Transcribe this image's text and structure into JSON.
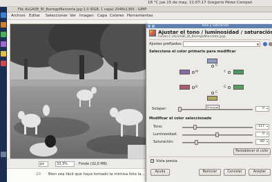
{
  "topbar": {
    "status_text": "18 °C  jue 15 de may, 11:07:17   Gregorio Pérez Compañ"
  },
  "window": {
    "title": "File  ALGADE_BI_BorregoMarcente.jpg-1.0 (RGB, 1 capa) 2048x1365 - GIMP",
    "menu": [
      "Archivo",
      "Editar",
      "Seleccionar",
      "Ver",
      "Imagen",
      "Capa",
      "Colores",
      "Herramientas"
    ]
  },
  "statusbar": {
    "unit": "px",
    "zoom": "33,3%",
    "info": "Fondo (32,0 MB)"
  },
  "doc": {
    "line_number": "20",
    "text": "Bien sea fácil que haya tomado la mimisa foto la..."
  },
  "dialog": {
    "titlebar": "Tono y saturación",
    "heading": "Ajustar el tono / luminosidad / saturación",
    "subheading": "Fondo-1 (ALGADE_BI_BorregoMarcente.jpg)",
    "presets_label": "Ajustes prefijados:",
    "primary_label": "Seleccione el color primario para modificar",
    "radio_labels": {
      "r": "R",
      "y": "Y",
      "g": "G",
      "c": "C",
      "b": "B",
      "m": "M"
    },
    "master_label": "Principal",
    "overlap_label": "Solapar:",
    "overlap_value": "0",
    "modify_label": "Modificar el color seleccionado",
    "hue_label": "Tono:",
    "hue_value": "-117",
    "lightness_label": "Luminosidad:",
    "lightness_value": "0",
    "saturation_label": "Saturación:",
    "saturation_value": "-60",
    "reset_color_label": "Restablecer el color",
    "preview_label": "Vista previa",
    "preview_checked": true,
    "buttons": {
      "help": "Ayuda",
      "reset": "Reiniciar",
      "cancel": "Cancelar",
      "ok": "Aceptar"
    }
  },
  "colors": {
    "swatch_red": "#8e9ec2",
    "swatch_yellow": "#8c6aa5",
    "swatch_green": "#4b9a63",
    "swatch_cyan": "#b05c6f",
    "swatch_blue": "#569f63",
    "swatch_magenta": "#b5a860",
    "titlebar": "#5e7fae",
    "launcher": "#1c2e52"
  },
  "sliders": {
    "hue_level": 0.18,
    "lightness_level": 0.5,
    "saturation_level": 0.2,
    "overlap_level": 0.0
  }
}
